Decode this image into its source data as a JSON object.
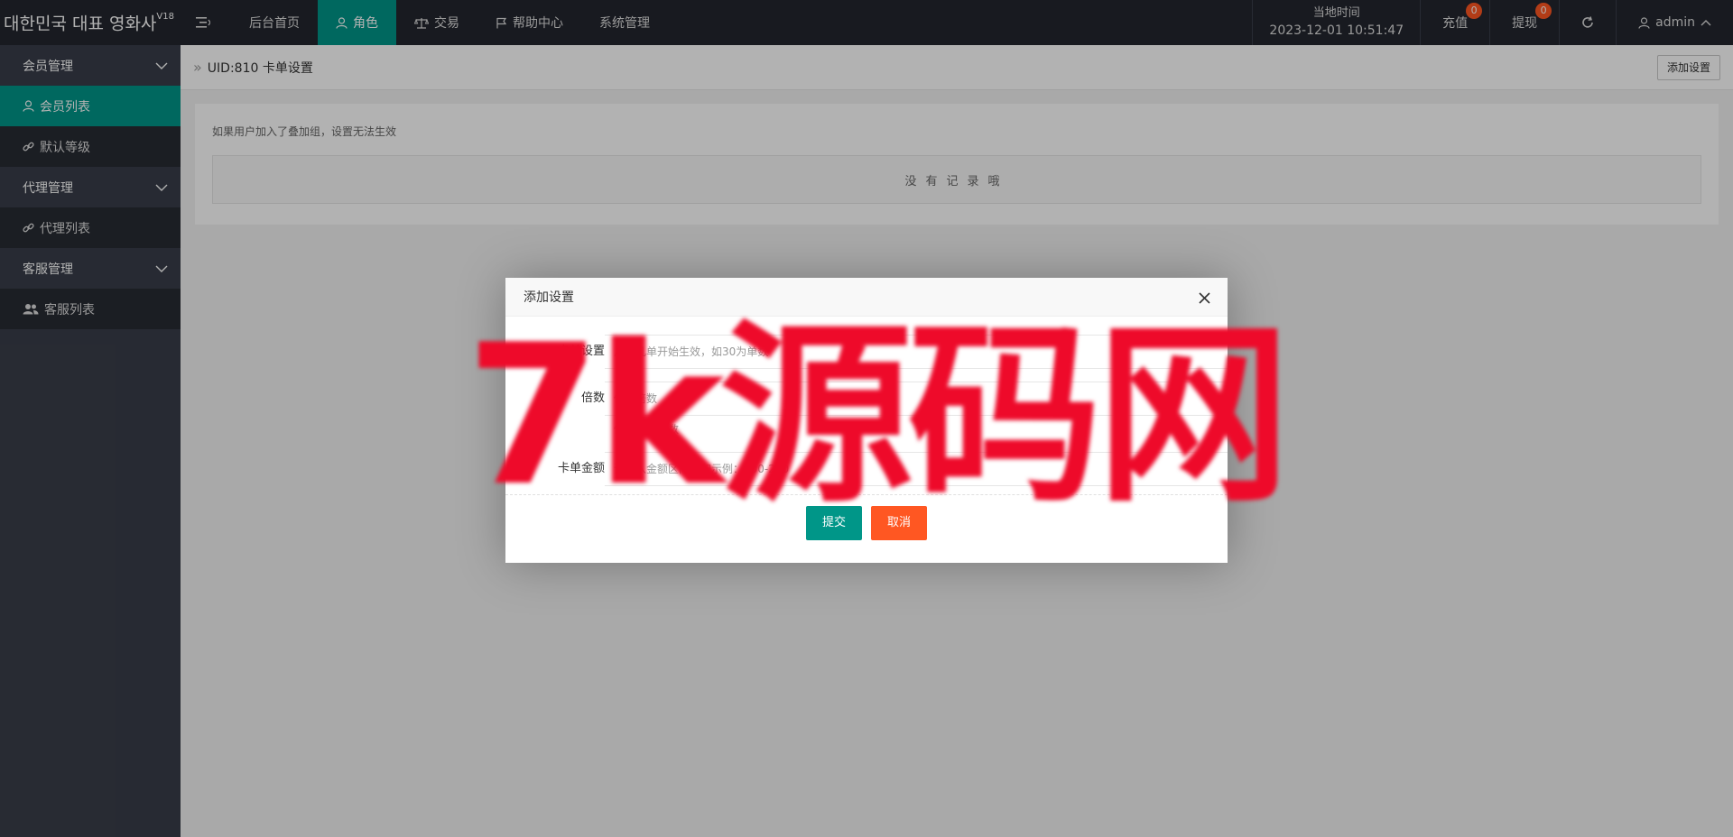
{
  "header": {
    "logo_text": "대한민국 대표 영화사",
    "logo_version": "V18",
    "nav": [
      {
        "label": "后台首页"
      },
      {
        "label": "角色"
      },
      {
        "label": "交易"
      },
      {
        "label": "帮助中心"
      },
      {
        "label": "系统管理"
      }
    ],
    "clock_label": "当地时间",
    "clock_value": "2023-12-01 10:51:47",
    "recharge_label": "充值",
    "recharge_count": "0",
    "withdraw_label": "提现",
    "withdraw_count": "0",
    "user_label": "admin"
  },
  "sidebar": {
    "groups": [
      {
        "label": "会员管理",
        "items": [
          {
            "label": "会员列表"
          },
          {
            "label": "默认等级"
          }
        ]
      },
      {
        "label": "代理管理",
        "items": [
          {
            "label": "代理列表"
          }
        ]
      },
      {
        "label": "客服管理",
        "items": [
          {
            "label": "客服列表"
          }
        ]
      }
    ]
  },
  "main": {
    "breadcrumb": "UID:810 卡单设置",
    "add_button": "添加设置",
    "tip": "如果用户加入了叠加组，设置无法生效",
    "empty_text": "没有记录哦"
  },
  "modal": {
    "title": "添加设置",
    "fields": [
      {
        "label": "卡单设置",
        "placeholder": "从第几单开始生效，如30为单数"
      },
      {
        "label": "倍数",
        "placeholder": "佣金倍数",
        "hint": "佣金返还倍数"
      },
      {
        "label": "卡单金额",
        "placeholder": "请输入金额区间，如示例：100-200"
      }
    ],
    "submit_label": "提交",
    "cancel_label": "取消"
  },
  "watermark": {
    "text": "7k源码网"
  },
  "colors": {
    "accent": "#009688",
    "danger": "#ff5722",
    "header_bg": "#23262e",
    "sidebar_bg": "#393d49",
    "watermark": "#ee0a2a"
  }
}
